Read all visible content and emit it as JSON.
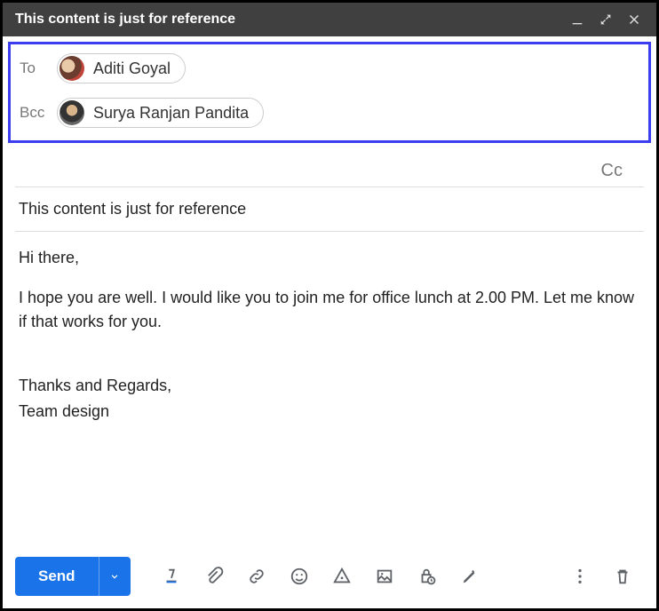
{
  "window": {
    "title": "This content is just for reference"
  },
  "recipients": {
    "to_label": "To",
    "bcc_label": "Bcc",
    "cc_label": "Cc",
    "to": {
      "name": "Aditi Goyal"
    },
    "bcc": {
      "name": "Surya Ranjan Pandita"
    }
  },
  "subject": "This content is just for reference",
  "body": {
    "greeting": "Hi there,",
    "para1": "I hope you are well. I would like you to join me for office lunch at 2.00 PM. Let me know if that works for you.",
    "signoff1": "Thanks and Regards,",
    "signoff2": "Team design"
  },
  "toolbar": {
    "send_label": "Send"
  }
}
